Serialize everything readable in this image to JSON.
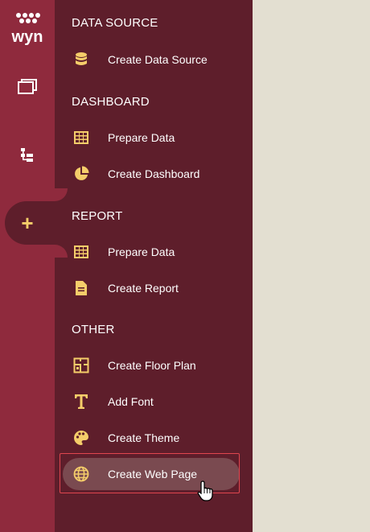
{
  "colors": {
    "rail": "#8f2a3d",
    "panel": "#5e1e2b",
    "accent": "#f5cd6a",
    "content": "#e3dfd1",
    "focus": "#e0464f"
  },
  "logo": {
    "text": "wyn"
  },
  "rail": {
    "items": [
      {
        "icon": "documents-icon"
      },
      {
        "icon": "hierarchy-icon"
      },
      {
        "icon": "plus-icon",
        "label": "+"
      }
    ]
  },
  "sections": {
    "data_source": {
      "title": "DATA SOURCE",
      "items": [
        {
          "label": "Create Data Source",
          "icon": "database-icon"
        }
      ]
    },
    "dashboard": {
      "title": "DASHBOARD",
      "items": [
        {
          "label": "Prepare Data",
          "icon": "table-icon"
        },
        {
          "label": "Create Dashboard",
          "icon": "pie-chart-icon"
        }
      ]
    },
    "report": {
      "title": "REPORT",
      "items": [
        {
          "label": "Prepare Data",
          "icon": "table-icon"
        },
        {
          "label": "Create Report",
          "icon": "document-icon"
        }
      ]
    },
    "other": {
      "title": "OTHER",
      "items": [
        {
          "label": "Create Floor Plan",
          "icon": "floor-plan-icon"
        },
        {
          "label": "Add Font",
          "icon": "font-icon"
        },
        {
          "label": "Create Theme",
          "icon": "palette-icon"
        },
        {
          "label": "Create Web Page",
          "icon": "globe-icon"
        }
      ]
    }
  }
}
